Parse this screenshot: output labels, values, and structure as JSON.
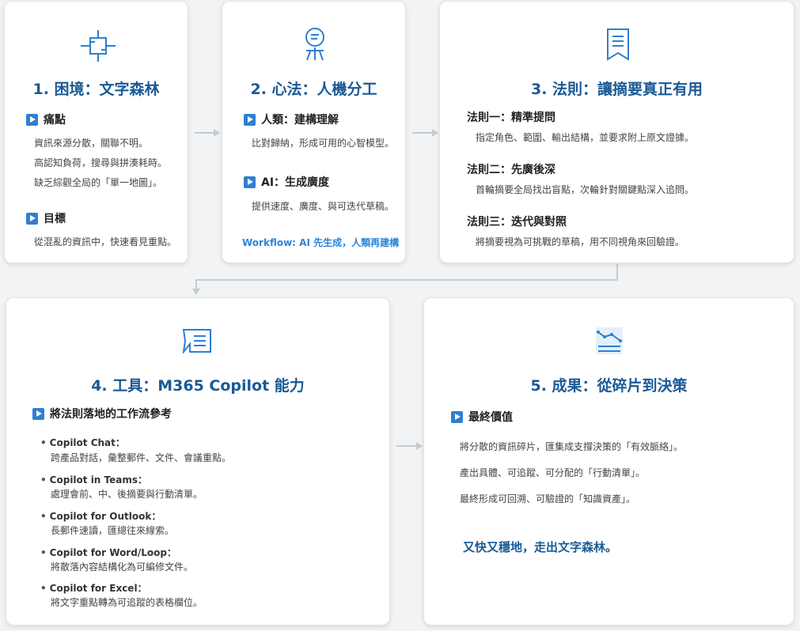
{
  "colors": {
    "accent": "#1a5a96",
    "bullet": "#2f7fd1",
    "workflow": "#2a85d8",
    "connector": "#c4ccd4"
  },
  "card1": {
    "icon": "chip-icon",
    "title": "1. 困境：文字森林",
    "pain_head": "痛點",
    "pain_lines": [
      "資訊來源分散，關聯不明。",
      "高認知負荷，搜尋與拼湊耗時。",
      "缺乏綜觀全局的「單一地圖」。"
    ],
    "goal_head": "目標",
    "goal_lines": [
      "從混亂的資訊中，快速看見重點。"
    ]
  },
  "card2": {
    "icon": "lightbulb-person-icon",
    "title": "2. 心法：人機分工",
    "human_head": "人類：建構理解",
    "human_line": "比對歸納，形成可用的心智模型。",
    "ai_head": "AI：生成廣度",
    "ai_line": "提供速度、廣度、與可迭代草稿。",
    "workflow": "Workflow: AI 先生成，人類再建構"
  },
  "card3": {
    "icon": "bookmark-document-icon",
    "title": "3. 法則：讓摘要真正有用",
    "rules": [
      {
        "head": "法則一：精準提問",
        "text": "指定角色、範圍、輸出結構，並要求附上原文證據。"
      },
      {
        "head": "法則二：先廣後深",
        "text": "首輪摘要全局找出盲點，次輪針對關鍵點深入追問。"
      },
      {
        "head": "法則三：迭代與對照",
        "text": "將摘要視為可挑戰的草稿，用不同視角來回驗證。"
      }
    ]
  },
  "card4": {
    "icon": "chat-document-icon",
    "title": "4. 工具：M365 Copilot 能力",
    "head": "將法則落地的工作流參考",
    "tools": [
      {
        "name": "Copilot Chat：",
        "desc": "跨產品對話，彙整郵件、文件、會議重點。"
      },
      {
        "name": "Copilot in Teams：",
        "desc": "處理會前、中、後摘要與行動清單。"
      },
      {
        "name": "Copilot for Outlook：",
        "desc": "長郵件速讀，匯總往來線索。"
      },
      {
        "name": "Copilot for Word/Loop：",
        "desc": "將散落內容結構化為可編修文件。"
      },
      {
        "name": "Copilot for Excel：",
        "desc": "將文字重點轉為可追蹤的表格欄位。"
      }
    ]
  },
  "card5": {
    "icon": "trend-chart-icon",
    "title": "5. 成果：從碎片到決策",
    "head": "最終價值",
    "lines": [
      "將分散的資訊碎片，匯集成支撐決策的「有效脈絡」。",
      "產出具體、可追蹤、可分配的「行動清單」。",
      "最終形成可回溯、可驗證的「知識資產」。"
    ],
    "closing": "又快又穩地，走出文字森林。"
  }
}
